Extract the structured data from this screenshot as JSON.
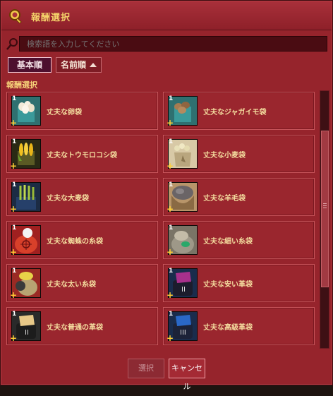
{
  "window": {
    "title": "報酬選択"
  },
  "search": {
    "placeholder": "検索語を入力してください",
    "value": ""
  },
  "sort": {
    "basic_label": "基本順",
    "name_label": "名前順"
  },
  "section": {
    "label": "報酬選択"
  },
  "items": [
    {
      "label": "丈夫な卵袋",
      "qty": "1",
      "icon": "egg-bag-icon"
    },
    {
      "label": "丈夫なジャガイモ袋",
      "qty": "1",
      "icon": "potato-bag-icon"
    },
    {
      "label": "丈夫なトウモロコシ袋",
      "qty": "1",
      "icon": "corn-bag-icon"
    },
    {
      "label": "丈夫な小麦袋",
      "qty": "1",
      "icon": "wheat-bag-icon"
    },
    {
      "label": "丈夫な大麦袋",
      "qty": "1",
      "icon": "barley-bag-icon"
    },
    {
      "label": "丈夫な羊毛袋",
      "qty": "1",
      "icon": "wool-bag-icon"
    },
    {
      "label": "丈夫な蜘蛛の糸袋",
      "qty": "1",
      "icon": "spider-silk-bag-icon"
    },
    {
      "label": "丈夫な細い糸袋",
      "qty": "1",
      "icon": "thin-thread-bag-icon"
    },
    {
      "label": "丈夫な太い糸袋",
      "qty": "1",
      "icon": "thick-thread-bag-icon"
    },
    {
      "label": "丈夫な安い革袋",
      "qty": "1",
      "icon": "cheap-leather-bag-icon"
    },
    {
      "label": "丈夫な普通の革袋",
      "qty": "1",
      "icon": "common-leather-bag-icon"
    },
    {
      "label": "丈夫な高級革袋",
      "qty": "1",
      "icon": "fine-leather-bag-icon"
    }
  ],
  "buttons": {
    "select": "選択",
    "cancel": "キャンセル"
  }
}
